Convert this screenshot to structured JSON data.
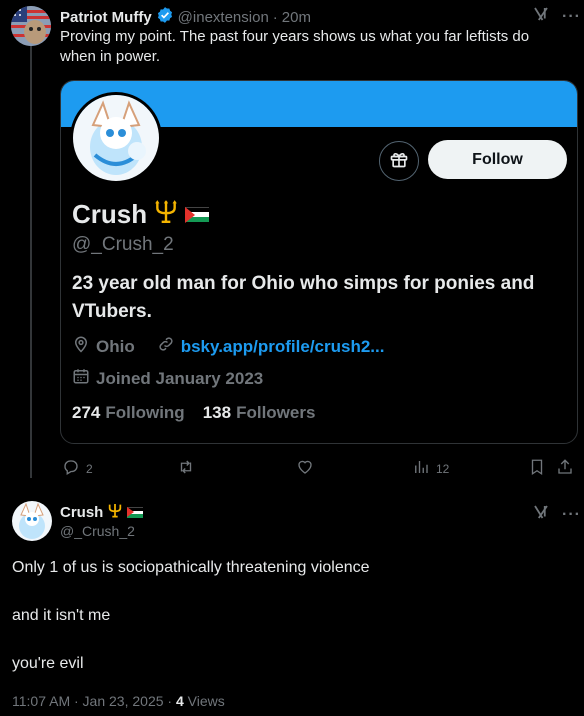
{
  "tweet1": {
    "author_name": "Patriot Muffy",
    "handle": "@inextension",
    "time": "20m",
    "text": "Proving my point. The past four years shows us what you far leftists do when in power."
  },
  "card": {
    "follow_label": "Follow",
    "name": "Crush",
    "handle": "@_Crush_2",
    "bio": "23 year old man for Ohio who simps for ponies and VTubers.",
    "location": "Ohio",
    "link": "bsky.app/profile/crush2...",
    "joined": "Joined January 2023",
    "following_count": "274",
    "following_label": "Following",
    "followers_count": "138",
    "followers_label": "Followers"
  },
  "actions": {
    "replies": "2",
    "views": "12"
  },
  "tweet2": {
    "author_name": "Crush",
    "handle": "@_Crush_2",
    "line1": "Only 1 of us is sociopathically threatening violence",
    "line2": "and it isn't me",
    "line3": "you're evil",
    "timestamp": "11:07 AM · Jan 23, 2025 · ",
    "views_count": "4",
    "views_label": " Views"
  },
  "colors": {
    "accent": "#1d9bf0",
    "muted": "#71767b",
    "text": "#e7e9ea",
    "border": "#2f3336"
  },
  "icons": [
    "verified-badge-icon",
    "grok-icon",
    "more-icon",
    "gift-icon",
    "location-icon",
    "link-icon",
    "calendar-icon",
    "reply-icon",
    "retweet-icon",
    "like-icon",
    "views-icon",
    "bookmark-icon",
    "share-icon",
    "trident-icon",
    "palestine-flag-icon"
  ]
}
